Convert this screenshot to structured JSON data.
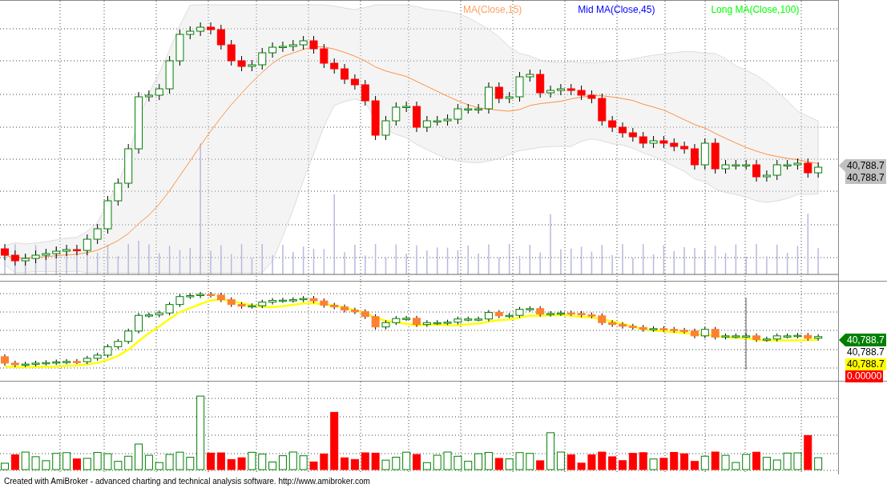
{
  "legend": [
    {
      "text": "MA(Close,15)",
      "color": "#ffa060"
    },
    {
      "text": "Mid MA(Close,45)",
      "color": "#0000ff"
    },
    {
      "text": "Long MA(Close,100)",
      "color": "#00ff00"
    }
  ],
  "price_labels": [
    {
      "text": "40,788.7",
      "kind": "arrow",
      "color": "#c0c0c0"
    },
    {
      "text": "40,788.7",
      "kind": "plain",
      "color": "#c0c0c0"
    }
  ],
  "indicator_labels": [
    {
      "text": "40,788.7",
      "kind": "arrow",
      "color": "#008000"
    },
    {
      "text": "40,788.7",
      "kind": "plain",
      "color": "#ffffff"
    },
    {
      "text": "40,788.7",
      "kind": "plain",
      "color": "#ffff00"
    },
    {
      "text": "0.00000",
      "kind": "plain",
      "color": "#ff0000"
    }
  ],
  "footer": "Created with AmiBroker - advanced charting and technical analysis software. http://www.amibroker.com"
}
